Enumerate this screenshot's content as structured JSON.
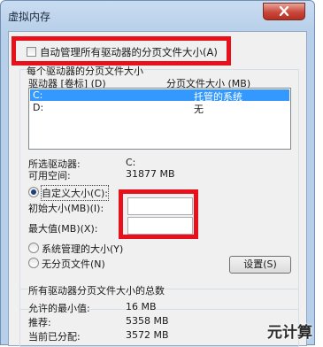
{
  "window": {
    "title": "虚拟内存",
    "close_glyph": "X"
  },
  "auto_manage": {
    "label": "自动管理所有驱动器的分页文件大小(A)",
    "checked": false
  },
  "group_each_drive": {
    "caption": "每个驱动器的分页文件大小",
    "col_drive": "驱动器 [卷标] (D)",
    "col_size": "分页文件大小 (MB)",
    "rows": [
      {
        "drive": "C:",
        "size": "托管的系统",
        "selected": true
      },
      {
        "drive": "D:",
        "size": "无",
        "selected": false
      }
    ]
  },
  "selected_drive": {
    "label": "所选驱动器:",
    "value": "C:",
    "space_label": "可用空间:",
    "space_value": "31877 MB"
  },
  "custom_size": {
    "label": "自定义大小(C):",
    "selected": true,
    "initial_label": "初始大小(MB)(I):",
    "initial_value": "",
    "max_label": "最大值(MB)(X):",
    "max_value": ""
  },
  "system_managed": {
    "label": "系统管理的大小(Y)",
    "selected": false
  },
  "no_paging": {
    "label": "无分页文件(N)",
    "selected": false
  },
  "set_button": "设置(S)",
  "totals": {
    "caption": "所有驱动器分页文件大小的总数",
    "min_label": "允许的最小值:",
    "min_value": "16 MB",
    "recommended_label": "推荐:",
    "recommended_value": "5358 MB",
    "current_label": "当前已分配:",
    "current_value": "3572 MB"
  },
  "watermark": "元计算",
  "colors": {
    "highlight": "#e8111b",
    "selection": "#3399ff"
  }
}
